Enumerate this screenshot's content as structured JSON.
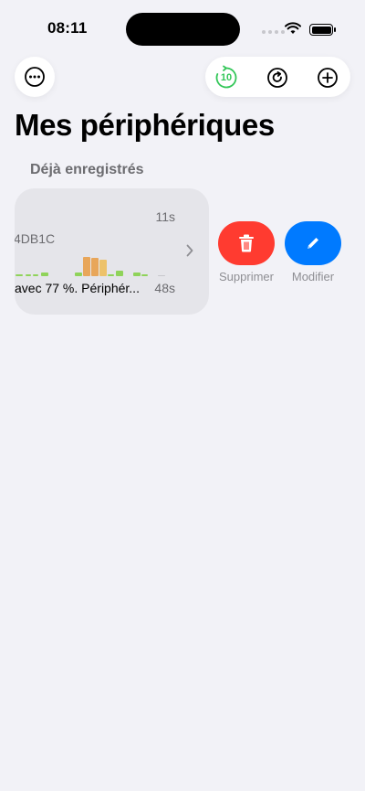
{
  "status_bar": {
    "time": "08:11"
  },
  "toolbar": {
    "timer_value": "10"
  },
  "page": {
    "title": "Mes périphériques",
    "section_header": "Déjà enregistrés"
  },
  "device": {
    "id_text": "4DB1C",
    "duration_top": "11s",
    "duration_bottom": "48s",
    "subtitle": "avec 77 %. Périphér..."
  },
  "actions": {
    "delete_label": "Supprimer",
    "edit_label": "Modifier"
  },
  "colors": {
    "background": "#f2f2f7",
    "card": "#e5e5ea",
    "delete": "#ff3b30",
    "edit": "#007aff",
    "accent_green": "#34c759",
    "bar_orange": "#e8a65a",
    "bar_green": "#8fd35a"
  }
}
